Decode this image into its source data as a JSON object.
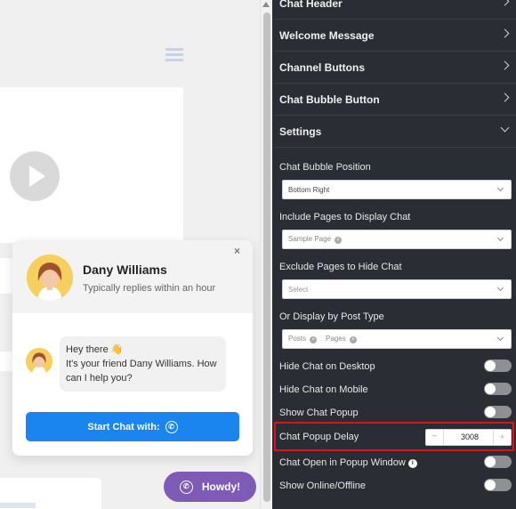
{
  "preview": {
    "agent": {
      "name": "Dany Williams",
      "status": "Typically replies within an hour"
    },
    "close_glyph": "×",
    "message": {
      "line1": "Hey there 👋",
      "line2": "It's your friend Dany Williams. How",
      "line3": "can I help you?"
    },
    "start_button_label": "Start Chat with:",
    "bubble_label": "Howdy!",
    "accent_color": "#1a84ef",
    "bubble_color": "#7d5bb6"
  },
  "panel": {
    "sections": {
      "chat_header": "Chat Header",
      "welcome_message": "Welcome Message",
      "channel_buttons": "Channel Buttons",
      "chat_bubble_button": "Chat Bubble Button",
      "settings": "Settings"
    },
    "settings": {
      "bubble_position": {
        "label": "Chat Bubble Position",
        "value": "Bottom Right"
      },
      "include_pages": {
        "label": "Include Pages to Display Chat",
        "tags": [
          "Sample Page"
        ]
      },
      "exclude_pages": {
        "label": "Exclude Pages to Hide Chat",
        "placeholder": "Select"
      },
      "post_type": {
        "label": "Or Display by Post Type",
        "tags": [
          "Posts",
          "Pages"
        ]
      },
      "hide_desktop": {
        "label": "Hide Chat on Desktop",
        "enabled": false
      },
      "hide_mobile": {
        "label": "Hide Chat on Mobile",
        "enabled": false
      },
      "show_popup": {
        "label": "Show Chat Popup",
        "enabled": false
      },
      "popup_delay": {
        "label": "Chat Popup Delay",
        "value": "3008",
        "minus": "−",
        "plus": "+"
      },
      "open_in_popup": {
        "label": "Chat Open in Popup Window",
        "info": "i",
        "enabled": false
      },
      "show_online": {
        "label": "Show Online/Offline",
        "enabled": false
      }
    },
    "highlight_color": "#e0101d"
  }
}
